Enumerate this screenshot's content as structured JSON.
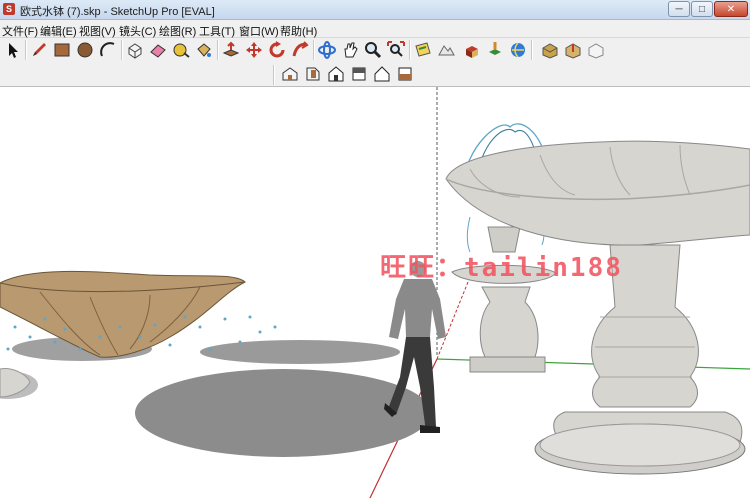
{
  "window": {
    "title": "欧式水钵 (7).skp - SketchUp Pro [EVAL]",
    "app_icon_glyph": "S",
    "minimize_glyph": "─",
    "maximize_glyph": "□",
    "close_glyph": "✕"
  },
  "menu": [
    "文件(F)",
    "编辑(E)",
    "视图(V)",
    "镜头(C)",
    "绘图(R)",
    "工具(T)",
    "窗口(W)",
    "帮助(H)"
  ],
  "toolbar_main": [
    "select-icon",
    "pencil-icon",
    "rectangle-icon",
    "circle-icon",
    "arc-icon",
    "make-component-icon",
    "eraser-icon",
    "tape-measure-icon",
    "paint-bucket-icon",
    "push-pull-icon",
    "move-icon",
    "rotate-icon",
    "follow-me-icon",
    "orbit-icon",
    "pan-icon",
    "zoom-icon",
    "zoom-extents-icon",
    "add-location-icon",
    "toggle-terrain-icon",
    "get-models-icon",
    "share-model-icon",
    "photo-textures-icon",
    "extension-warehouse-icon",
    "share-component-icon",
    "layout-icon"
  ],
  "toolbar_views": [
    "iso-view-icon",
    "top-view-icon",
    "front-view-icon",
    "right-view-icon",
    "back-view-icon",
    "left-view-icon"
  ],
  "scene": {
    "watermark": "旺旺：tailin188",
    "colors": {
      "stone": "#d7d5d0",
      "stone_shadow": "#a9a7a2",
      "bronze": "#b89970",
      "shadow": "#8c8c8c",
      "axis_green": "#3aa63a",
      "axis_red": "#c03030",
      "water": "#5fa6c8"
    }
  }
}
